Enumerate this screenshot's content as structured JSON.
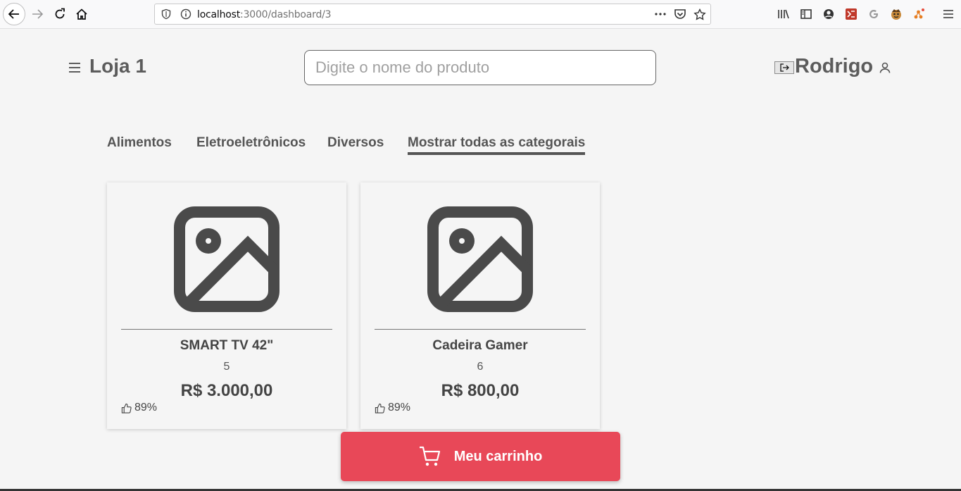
{
  "browser": {
    "url_host": "localhost",
    "url_path": ":3000/dashboard/3"
  },
  "header": {
    "store_title": "Loja 1",
    "search_placeholder": "Digite o nome do produto",
    "user_name": "Rodrigo"
  },
  "tabs": [
    {
      "label": "Alimentos",
      "active": false
    },
    {
      "label": "Eletroeletrônicos",
      "active": false
    },
    {
      "label": "Diversos",
      "active": false
    },
    {
      "label": "Mostrar todas as categorais",
      "active": true
    }
  ],
  "products": [
    {
      "name": "SMART TV 42\"",
      "quantity": "5",
      "price": "R$ 3.000,00",
      "rating": "89%"
    },
    {
      "name": "Cadeira Gamer",
      "quantity": "6",
      "price": "R$ 800,00",
      "rating": "89%"
    }
  ],
  "cart": {
    "label": "Meu carrinho",
    "color": "#e84858"
  }
}
